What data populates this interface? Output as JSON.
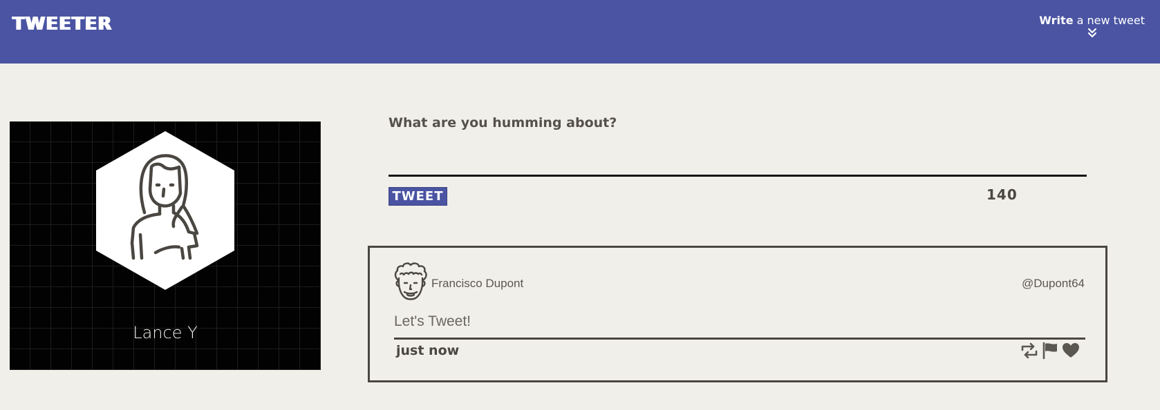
{
  "nav": {
    "brand": "TWEETER",
    "write_bold": "Write",
    "write_rest": " a new tweet"
  },
  "profile": {
    "name": "Lance Y"
  },
  "compose": {
    "label": "What are you humming about?",
    "input_value": "",
    "button_label": "Tweet",
    "counter": "140"
  },
  "tweet": {
    "author": "Francisco Dupont",
    "handle": "@Dupont64",
    "text": "Let's Tweet!",
    "time": "just now",
    "actions": [
      "retweet-icon",
      "flag-icon",
      "heart-icon"
    ]
  },
  "colors": {
    "nav_bg": "#4a54a2",
    "page_bg": "#f1efea",
    "ink": "#4a4641"
  }
}
